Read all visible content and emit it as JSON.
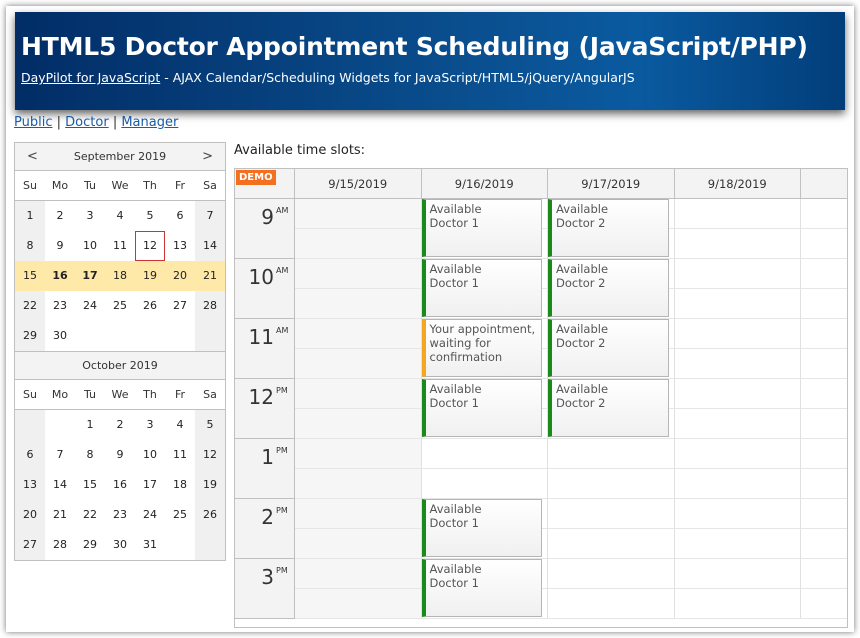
{
  "header": {
    "title": "HTML5 Doctor Appointment Scheduling (JavaScript/PHP)",
    "sub_link": "DayPilot for JavaScript",
    "sub_text": " - AJAX Calendar/Scheduling Widgets for JavaScript/HTML5/jQuery/AngularJS"
  },
  "links": {
    "public": "Public",
    "doctor": "Doctor",
    "manager": "Manager",
    "sep": "|"
  },
  "navigator": {
    "prev": "<",
    "next": ">",
    "dows": [
      "Su",
      "Mo",
      "Tu",
      "We",
      "Th",
      "Fr",
      "Sa"
    ],
    "months": [
      {
        "title": "September 2019",
        "weeks": [
          [
            "1",
            "2",
            "3",
            "4",
            "5",
            "6",
            "7"
          ],
          [
            "8",
            "9",
            "10",
            "11",
            "12",
            "13",
            "14"
          ],
          [
            "15",
            "16",
            "17",
            "18",
            "19",
            "20",
            "21"
          ],
          [
            "22",
            "23",
            "24",
            "25",
            "26",
            "27",
            "28"
          ],
          [
            "29",
            "30",
            "",
            "",
            "",
            "",
            ""
          ]
        ],
        "selected_week": 2,
        "bold_days": [
          "16",
          "17"
        ],
        "today": "12"
      },
      {
        "title": "October 2019",
        "weeks": [
          [
            "",
            "",
            "1",
            "2",
            "3",
            "4",
            "5"
          ],
          [
            "6",
            "7",
            "8",
            "9",
            "10",
            "11",
            "12"
          ],
          [
            "13",
            "14",
            "15",
            "16",
            "17",
            "18",
            "19"
          ],
          [
            "20",
            "21",
            "22",
            "23",
            "24",
            "25",
            "26"
          ],
          [
            "27",
            "28",
            "29",
            "30",
            "31",
            "",
            ""
          ]
        ]
      }
    ]
  },
  "calendar": {
    "label": "Available time slots:",
    "demo": "DEMO",
    "columns": [
      "9/15/2019",
      "9/16/2019",
      "9/17/2019",
      "9/18/2019"
    ],
    "hours": [
      {
        "h": "9",
        "ap": "AM"
      },
      {
        "h": "10",
        "ap": "AM"
      },
      {
        "h": "11",
        "ap": "AM"
      },
      {
        "h": "12",
        "ap": "PM"
      },
      {
        "h": "1",
        "ap": "PM"
      },
      {
        "h": "2",
        "ap": "PM"
      },
      {
        "h": "3",
        "ap": "PM"
      }
    ],
    "events": [
      {
        "col": 1,
        "row": 0,
        "lines": [
          "Available",
          "Doctor 1"
        ],
        "status": "free"
      },
      {
        "col": 2,
        "row": 0,
        "lines": [
          "Available",
          "Doctor 2"
        ],
        "status": "free"
      },
      {
        "col": 1,
        "row": 1,
        "lines": [
          "Available",
          "Doctor 1"
        ],
        "status": "free"
      },
      {
        "col": 2,
        "row": 1,
        "lines": [
          "Available",
          "Doctor 2"
        ],
        "status": "free"
      },
      {
        "col": 1,
        "row": 2,
        "lines": [
          "Your appointment,",
          "waiting for",
          "confirmation"
        ],
        "status": "pending"
      },
      {
        "col": 2,
        "row": 2,
        "lines": [
          "Available",
          "Doctor 2"
        ],
        "status": "free"
      },
      {
        "col": 1,
        "row": 3,
        "lines": [
          "Available",
          "Doctor 1"
        ],
        "status": "free"
      },
      {
        "col": 2,
        "row": 3,
        "lines": [
          "Available",
          "Doctor 2"
        ],
        "status": "free"
      },
      {
        "col": 1,
        "row": 5,
        "lines": [
          "Available",
          "Doctor 1"
        ],
        "status": "free"
      },
      {
        "col": 1,
        "row": 6,
        "lines": [
          "Available",
          "Doctor 1"
        ],
        "status": "free"
      }
    ],
    "colors": {
      "free": "#1a8a1a",
      "pending": "#f4a620"
    }
  }
}
